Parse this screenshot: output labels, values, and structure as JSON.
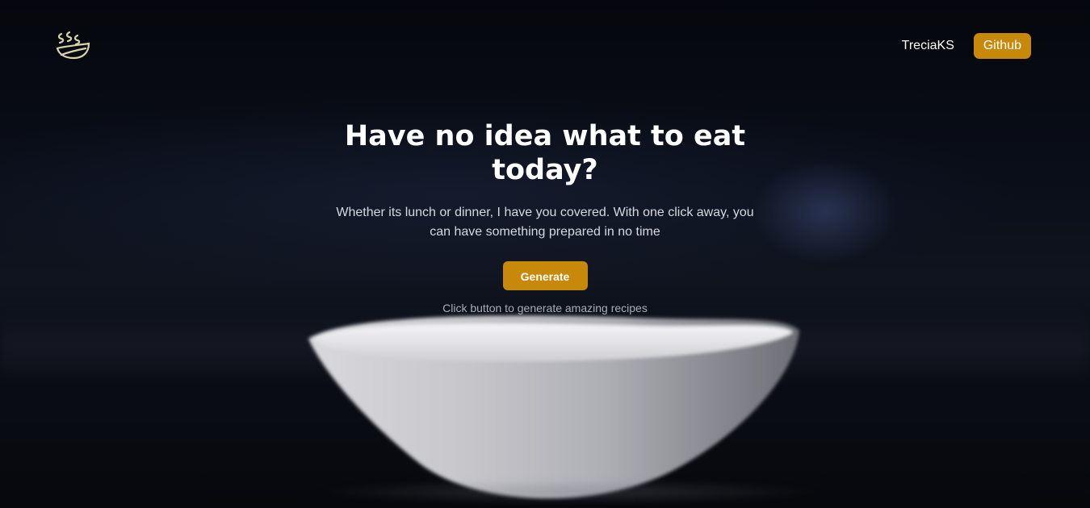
{
  "header": {
    "logo_icon": "steaming-bowl-icon",
    "nav_user": "TreciaKS",
    "github_label": "Github"
  },
  "hero": {
    "title": "Have no idea what to eat today?",
    "subtitle": "Whether its lunch or dinner, I have you covered. With one click away, you can have something prepared in no time",
    "generate_label": "Generate",
    "hint": "Click button to generate amazing recipes"
  },
  "colors": {
    "accent": "#c8880a",
    "background": "#07090f",
    "text": "#ffffff",
    "muted_text": "#a9adb6"
  },
  "background_image": "white-bowl-on-dark-table"
}
